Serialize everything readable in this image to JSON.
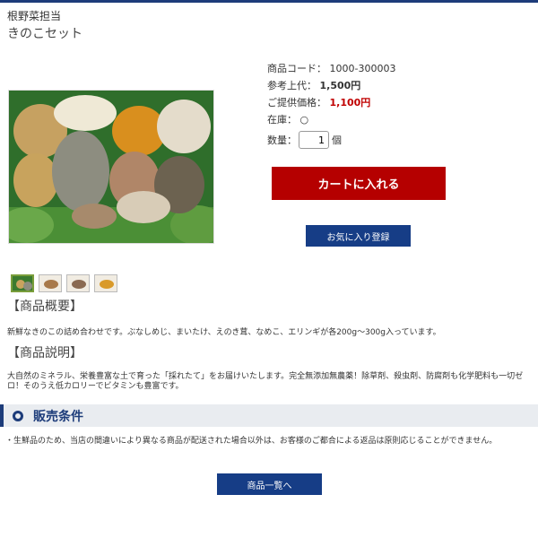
{
  "header": {
    "shop_name": "根野菜担当",
    "product_title": "きのこセット"
  },
  "product": {
    "code_label": "商品コード：",
    "code_value": "1000-300003",
    "ref_price_label": "参考上代：",
    "ref_price_value": "1,500円",
    "price_label": "ご提供価格：",
    "price_value": "1,100円",
    "stock_label": "在庫：",
    "stock_value": "○",
    "qty_label": "数量：",
    "qty_value": "1",
    "qty_unit": "個"
  },
  "buttons": {
    "cart": "カートに入れる",
    "favorite": "お気に入り登録",
    "list": "商品一覧へ"
  },
  "sections": {
    "overview_heading": "【商品概要】",
    "overview_text": "新鮮なきのこの詰め合わせです。ぶなしめじ、まいたけ、えのき茸、なめこ、エリンギが各200g～300g入っています。",
    "description_heading": "【商品説明】",
    "description_text": "大自然のミネラル、栄養豊富な土で育った「採れたて」をお届けいたします。完全無添加無農薬！除草剤、殺虫剤、防腐剤も化学肥料も一切ゼロ！そのうえ低カロリーでビタミンも豊富です。"
  },
  "conditions": {
    "title": "販売条件",
    "text": "・生鮮品のため、当店の間違いにより異なる商品が配送された場合以外は、お客様のご都合による返品は原則応じることができません。"
  },
  "colors": {
    "accent": "#1d3c7a",
    "cart": "#b50000",
    "price": "#c00000"
  }
}
